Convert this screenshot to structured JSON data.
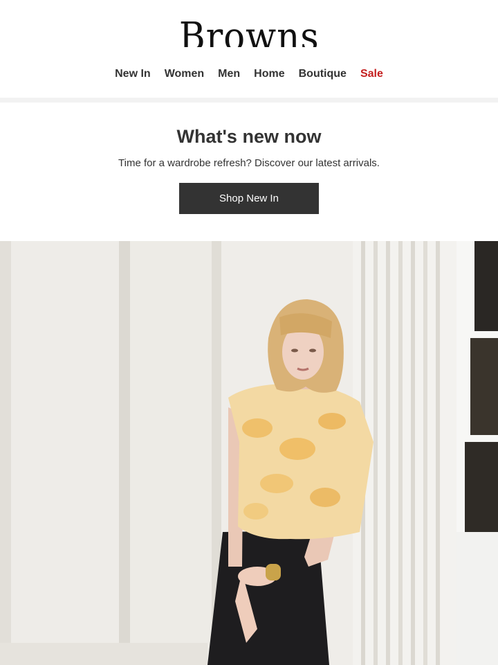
{
  "brand": {
    "logo_text": "Browns"
  },
  "nav": {
    "items": [
      {
        "label": "New In"
      },
      {
        "label": "Women"
      },
      {
        "label": "Men"
      },
      {
        "label": "Home"
      },
      {
        "label": "Boutique"
      },
      {
        "label": "Sale"
      }
    ]
  },
  "promo": {
    "title": "What's new now",
    "subtitle": "Time for a wardrobe refresh? Discover our latest arrivals.",
    "button_label": "Shop New In"
  },
  "colors": {
    "text": "#333333",
    "sale": "#c41f1f",
    "button_bg": "#333333",
    "button_text": "#ffffff",
    "divider": "#f2f2f2"
  }
}
